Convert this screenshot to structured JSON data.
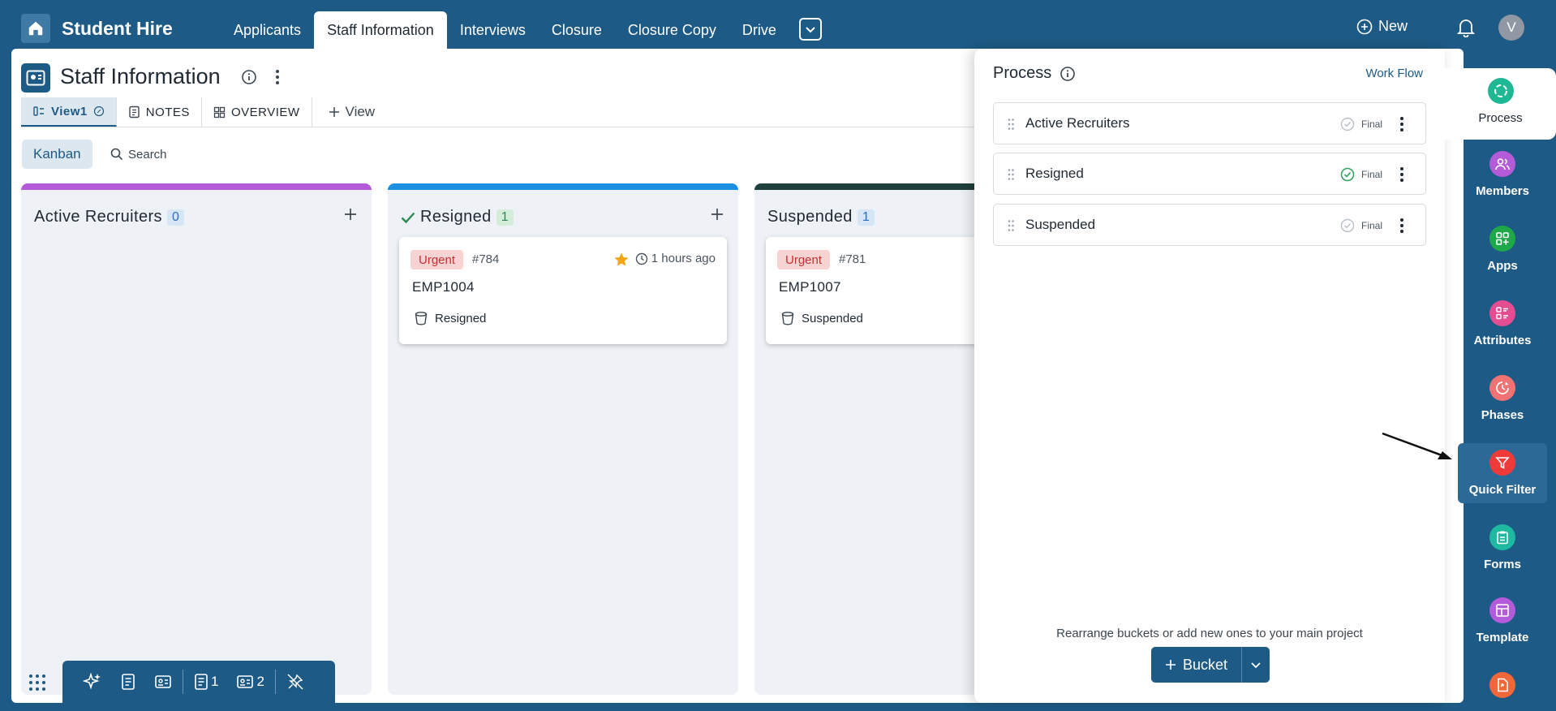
{
  "header": {
    "app_title": "Student Hire",
    "tabs": [
      {
        "label": "Applicants",
        "active": false
      },
      {
        "label": "Staff Information",
        "active": true
      },
      {
        "label": "Interviews",
        "active": false
      },
      {
        "label": "Closure",
        "active": false
      },
      {
        "label": "Closure Copy",
        "active": false
      },
      {
        "label": "Drive",
        "active": false
      }
    ],
    "new_label": "New",
    "avatar_initial": "V",
    "icons": [
      "home-icon",
      "chevron-down-icon",
      "plus-circle-icon",
      "bell-icon"
    ]
  },
  "page": {
    "title": "Staff Information",
    "view_tabs": {
      "view1": "View1",
      "notes": "NOTES",
      "overview": "OVERVIEW",
      "add_view": "View"
    },
    "kanban_label": "Kanban",
    "search_label": "Search"
  },
  "columns": [
    {
      "name": "Active Recruiters",
      "count": "0",
      "color": "#b35bd9",
      "count_style": "blue",
      "checked": false,
      "cards": []
    },
    {
      "name": "Resigned",
      "count": "1",
      "color": "#1b8fe0",
      "count_style": "green",
      "checked": true,
      "card": {
        "priority": "Urgent",
        "id": "#784",
        "starred": true,
        "time": "1 hours ago",
        "title": "EMP1004",
        "bucket": "Resigned"
      }
    },
    {
      "name": "Suspended",
      "count": "1",
      "color": "#1f3f3a",
      "count_style": "blue",
      "checked": false,
      "card": {
        "priority": "Urgent",
        "id": "#781",
        "title": "EMP1007",
        "bucket": "Suspended"
      }
    }
  ],
  "bottom_toolbar": {
    "notes_count": "1",
    "cards_count": "2",
    "icons": [
      "apps-grid-icon",
      "sparkle-icon",
      "note-icon",
      "id-card-icon",
      "note-count-icon",
      "card-count-icon",
      "unpin-icon"
    ]
  },
  "process_panel": {
    "title": "Process",
    "workflow_link": "Work Flow",
    "buckets": [
      {
        "name": "Active Recruiters",
        "final_label": "Final",
        "final_checked": false
      },
      {
        "name": "Resigned",
        "final_label": "Final",
        "final_checked": true
      },
      {
        "name": "Suspended",
        "final_label": "Final",
        "final_checked": false
      }
    ],
    "hint": "Rearrange buckets or add new ones to your main project",
    "bucket_button": "Bucket"
  },
  "sidebar": {
    "items": [
      {
        "label": "Process",
        "color": "#1fb894",
        "active": true
      },
      {
        "label": "Members",
        "color": "#b35bd9"
      },
      {
        "label": "Apps",
        "color": "#1fa84a"
      },
      {
        "label": "Attributes",
        "color": "#e54d92"
      },
      {
        "label": "Phases",
        "color": "#f07272"
      },
      {
        "label": "Quick Filter",
        "color": "#f03a3a",
        "highlighted": true
      },
      {
        "label": "Forms",
        "color": "#1fb8a0"
      },
      {
        "label": "Template",
        "color": "#b35bd9"
      }
    ]
  }
}
